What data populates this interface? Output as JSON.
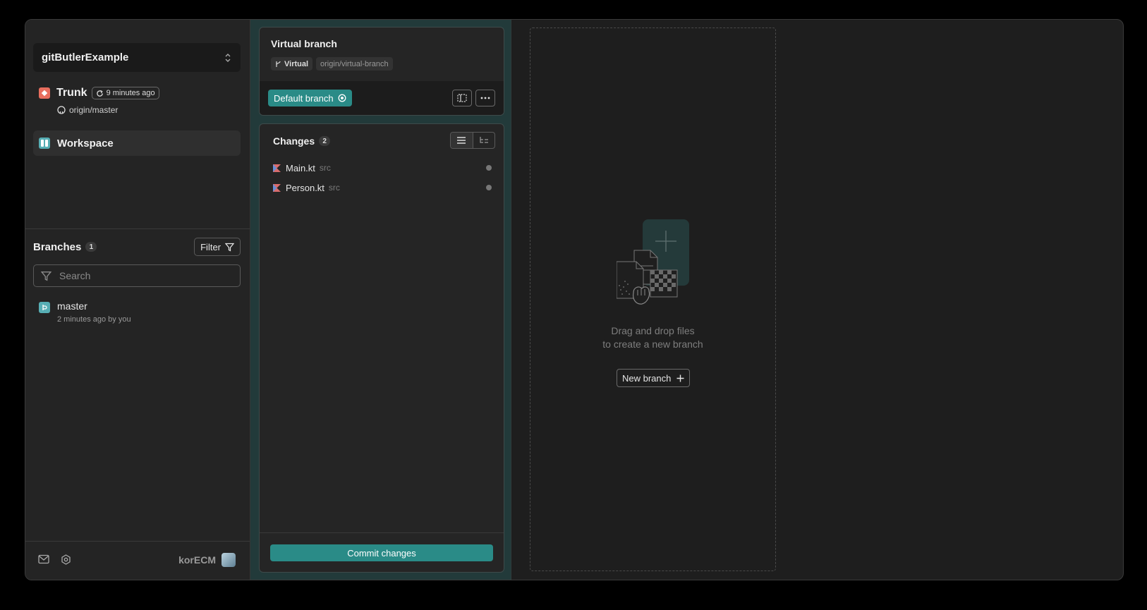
{
  "project": {
    "name": "gitButlerExample"
  },
  "trunk": {
    "title": "Trunk",
    "updated": "9 minutes ago",
    "remote": "origin/master"
  },
  "workspace": {
    "label": "Workspace"
  },
  "branches": {
    "title": "Branches",
    "count": "1",
    "filter_label": "Filter",
    "search_placeholder": "Search",
    "items": [
      {
        "name": "master",
        "meta": "2 minutes ago by you"
      }
    ]
  },
  "footer": {
    "user": "korECM"
  },
  "lane": {
    "branch_name": "Virtual branch",
    "tag_virtual": "Virtual",
    "tag_remote": "origin/virtual-branch",
    "default_branch_label": "Default branch",
    "changes_title": "Changes",
    "changes_count": "2",
    "files": [
      {
        "name": "Main.kt",
        "dir": "src"
      },
      {
        "name": "Person.kt",
        "dir": "src"
      }
    ],
    "commit_label": "Commit changes"
  },
  "dropzone": {
    "line1": "Drag and drop files",
    "line2": "to create a new branch",
    "new_branch_label": "New branch"
  },
  "colors": {
    "accent": "#2a8b87",
    "trunk_icon": "#e86e5e",
    "workspace_icon": "#57aeb4"
  }
}
